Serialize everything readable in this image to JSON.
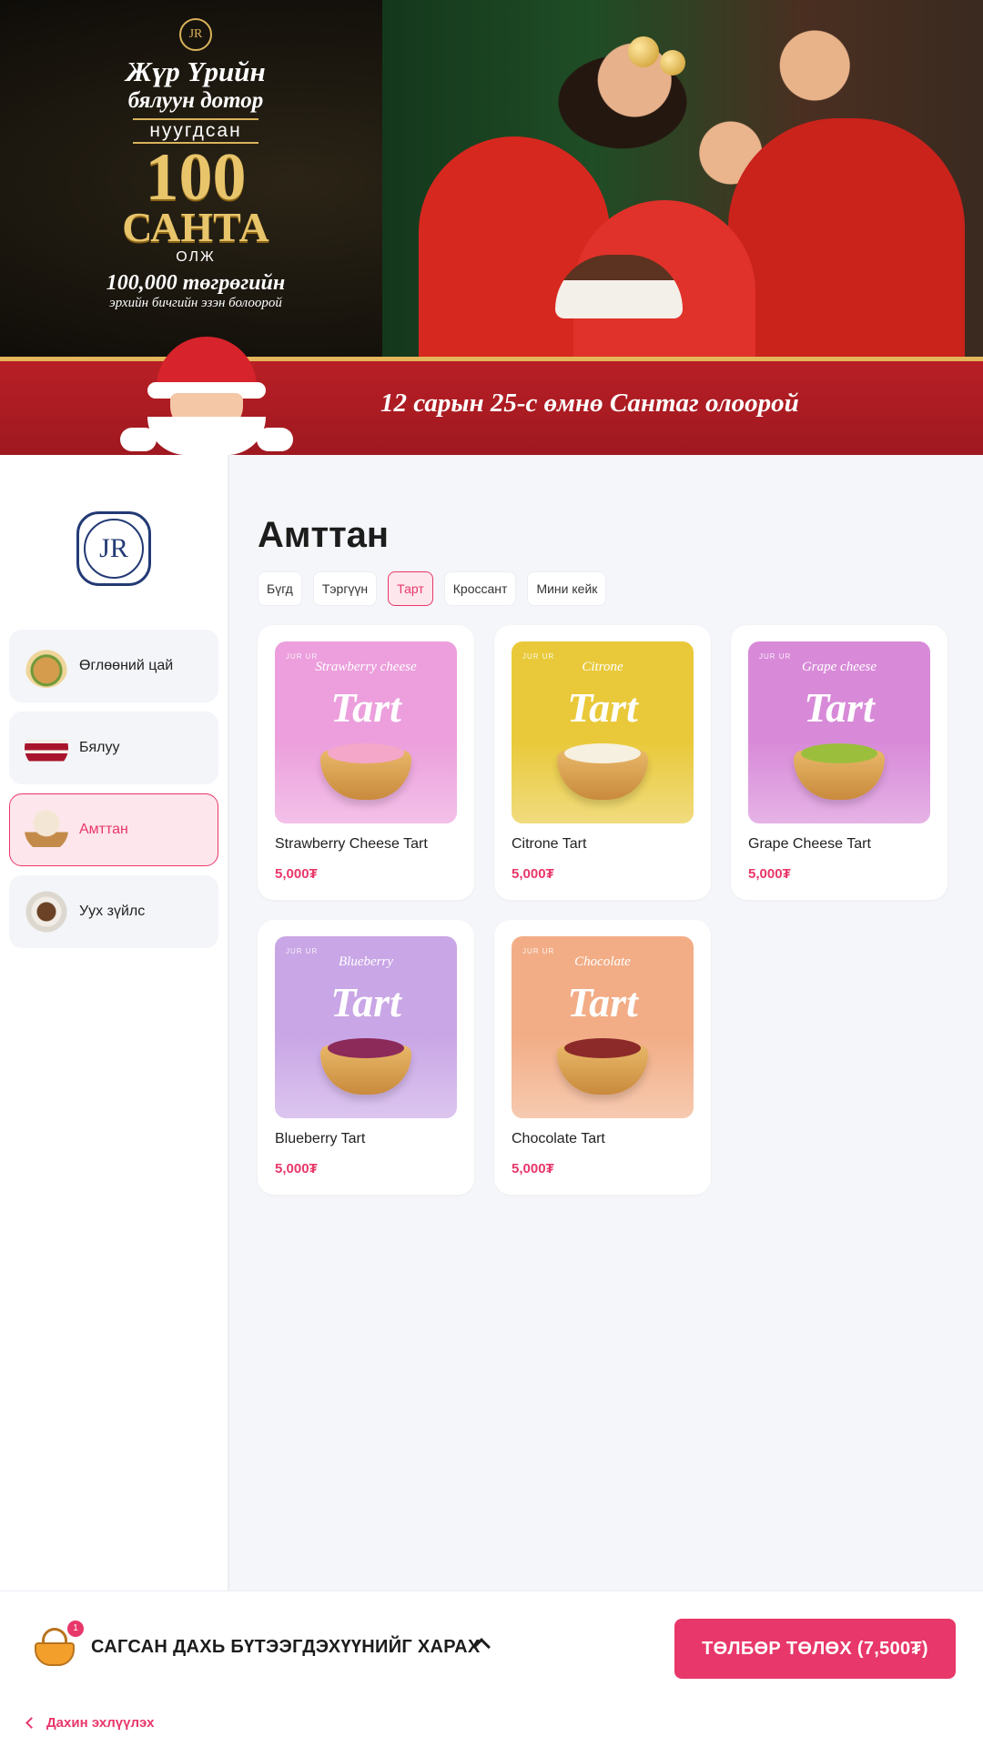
{
  "banner": {
    "promo_seal": "JR",
    "promo_line1": "Жүр Үрийн",
    "promo_line2": "бялуун дотор",
    "promo_line3": "нуугдсан",
    "promo_line4": "100",
    "promo_line5": "САНТА",
    "promo_line6": "ОЛЖ",
    "promo_line7": "100,000 төгрөгийн",
    "promo_line8": "эрхийн бичгийн эзэн болоорой",
    "tagline": "12 сарын 25-с өмнө Сантаг олоорой"
  },
  "sidebar": {
    "logo": "JR",
    "items": [
      {
        "label": "Өглөөний цай",
        "icon": "sandwich-icon"
      },
      {
        "label": "Бялуу",
        "icon": "cake-icon"
      },
      {
        "label": "Амттан",
        "icon": "cupcake-icon",
        "active": true
      },
      {
        "label": "Уух зүйлс",
        "icon": "coffee-icon"
      }
    ]
  },
  "main": {
    "title": "Амттан",
    "filters": [
      {
        "label": "Бүгд"
      },
      {
        "label": "Тэргүүн"
      },
      {
        "label": "Тарт",
        "active": true
      },
      {
        "label": "Кроссант"
      },
      {
        "label": "Мини кейк"
      }
    ],
    "products": [
      {
        "name": "Strawberry Cheese Tart",
        "price": "5,000₮",
        "image_sub": "Strawberry cheese",
        "image_title": "Tart",
        "image_brand": "JUR UR",
        "bg": "#ec9fdc",
        "filling": "#f4a7c9"
      },
      {
        "name": "Citrone Tart",
        "price": "5,000₮",
        "image_sub": "Citrone",
        "image_title": "Tart",
        "image_brand": "JUR UR",
        "bg": "#e9c93a",
        "filling": "#f6f0e0"
      },
      {
        "name": "Grape Cheese Tart",
        "price": "5,000₮",
        "image_sub": "Grape cheese",
        "image_title": "Tart",
        "image_brand": "JUR UR",
        "bg": "#d88ad8",
        "filling": "#9bbf3c"
      },
      {
        "name": "Blueberry Tart",
        "price": "5,000₮",
        "image_sub": "Blueberry",
        "image_title": "Tart",
        "image_brand": "JUR UR",
        "bg": "#c9a6e6",
        "filling": "#8c2a5a"
      },
      {
        "name": "Chocolate Tart",
        "price": "5,000₮",
        "image_sub": "Chocolate",
        "image_title": "Tart",
        "image_brand": "JUR UR",
        "bg": "#f2ad86",
        "filling": "#8c2a2a"
      }
    ]
  },
  "footer": {
    "cart_count": "1",
    "cart_toggle_label": "САГСАН ДАХЬ БҮТЭЭГДЭХҮҮНИЙГ ХАРАХ",
    "pay_label": "ТӨЛБӨР ТӨЛӨХ (7,500₮)",
    "restart_label": "Дахин эхлүүлэх"
  },
  "colors": {
    "accent": "#e8376a",
    "accent_soft": "#fde6ec",
    "logo_navy": "#233a75",
    "banner_red": "#b81f25"
  }
}
